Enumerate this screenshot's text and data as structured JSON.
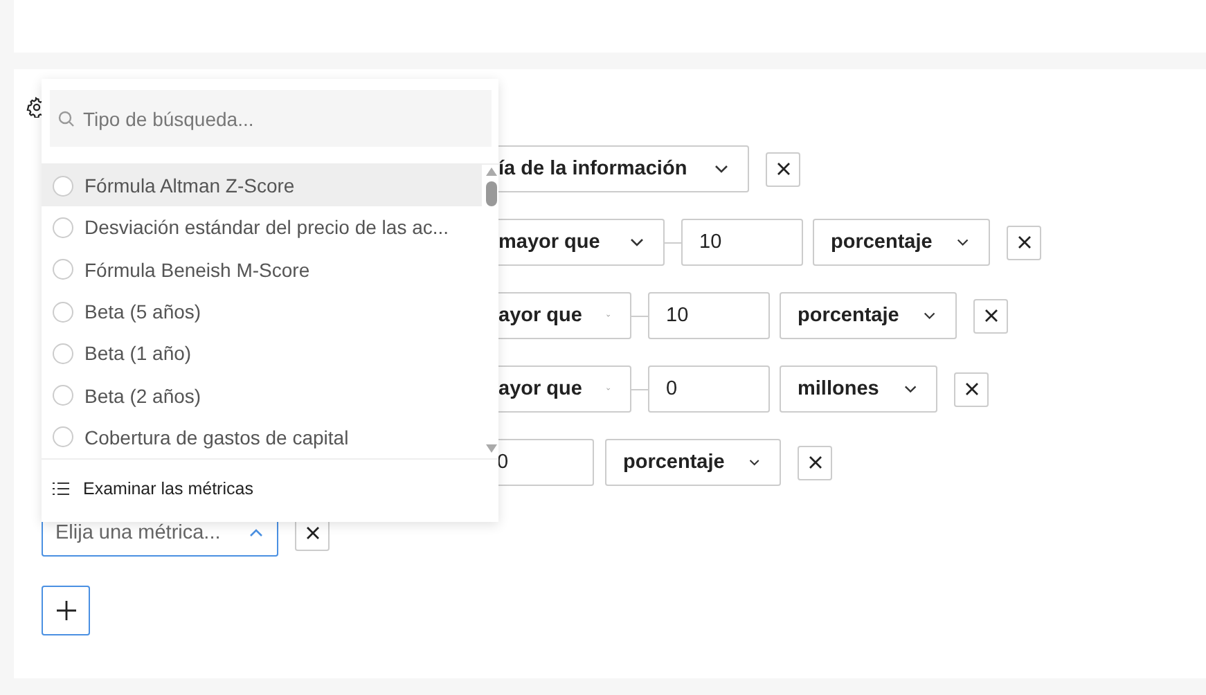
{
  "filter_rows": [
    {
      "controls": [
        {
          "kind": "select",
          "value": "ía de la información",
          "open": false
        }
      ]
    },
    {
      "controls": [
        {
          "kind": "select",
          "value": "mayor que",
          "open": false
        },
        {
          "kind": "input",
          "value": "10"
        },
        {
          "kind": "select",
          "value": "porcentaje",
          "open": false
        }
      ]
    },
    {
      "controls": [
        {
          "kind": "select",
          "value": "ayor que",
          "open": false
        },
        {
          "kind": "input",
          "value": "10"
        },
        {
          "kind": "select",
          "value": "porcentaje",
          "open": false
        }
      ]
    },
    {
      "controls": [
        {
          "kind": "select",
          "value": "ayor que",
          "open": false
        },
        {
          "kind": "input",
          "value": "0"
        },
        {
          "kind": "select",
          "value": "millones",
          "open": false
        }
      ]
    },
    {
      "controls": [
        {
          "kind": "input",
          "value": "0"
        },
        {
          "kind": "select",
          "value": "porcentaje",
          "open": false
        }
      ]
    }
  ],
  "metric_picker": {
    "placeholder": "Elija una métrica...",
    "open": true
  },
  "metric_dropdown": {
    "search": {
      "placeholder": "Tipo de búsqueda..."
    },
    "options": [
      {
        "label": "Fórmula Altman Z-Score",
        "highlighted": true,
        "selected": false
      },
      {
        "label": "Desviación estándar del precio de las ac...",
        "highlighted": false,
        "selected": false
      },
      {
        "label": "Fórmula Beneish M-Score",
        "highlighted": false,
        "selected": false
      },
      {
        "label": "Beta (5 años)",
        "highlighted": false,
        "selected": false
      },
      {
        "label": "Beta (1 año)",
        "highlighted": false,
        "selected": false
      },
      {
        "label": "Beta (2 años)",
        "highlighted": false,
        "selected": false
      },
      {
        "label": "Cobertura de gastos de capital",
        "highlighted": false,
        "selected": false
      }
    ],
    "footer": "Examinar las métricas"
  }
}
